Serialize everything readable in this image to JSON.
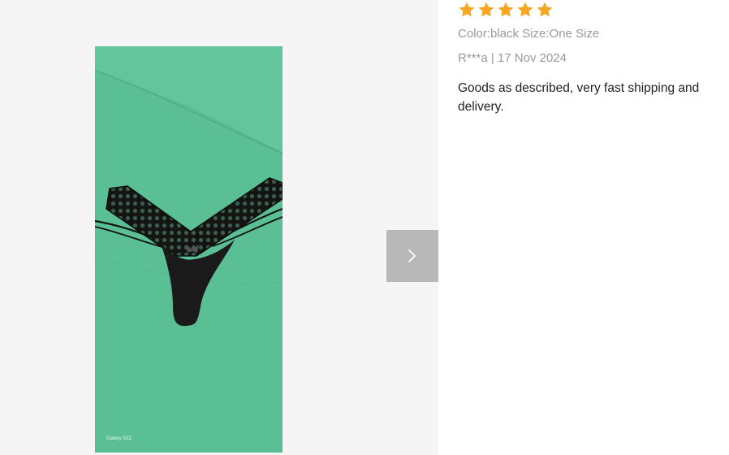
{
  "review": {
    "rating": 5,
    "rating_max": 5,
    "star_color": "#f5a623",
    "sku": "Color:black Size:One Size",
    "author": "R***a",
    "separator": "|",
    "date": "17 Nov 2024",
    "text": "Goods as described, very fast shipping and delivery."
  },
  "gallery": {
    "watermark": "Galaxy S22",
    "photo_background": "#5bbf95",
    "next_icon": "chevron-right-icon"
  }
}
